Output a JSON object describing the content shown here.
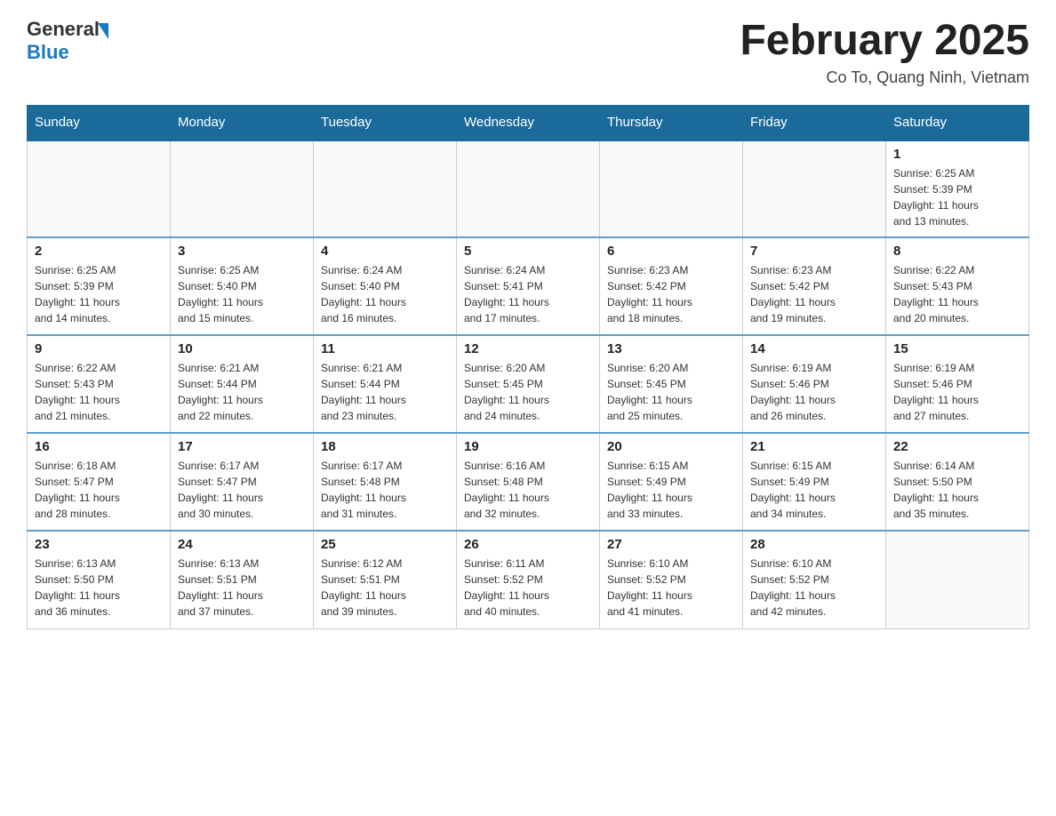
{
  "header": {
    "logo_general": "General",
    "logo_blue": "Blue",
    "month_title": "February 2025",
    "location": "Co To, Quang Ninh, Vietnam"
  },
  "weekdays": [
    "Sunday",
    "Monday",
    "Tuesday",
    "Wednesday",
    "Thursday",
    "Friday",
    "Saturday"
  ],
  "weeks": [
    [
      {
        "day": "",
        "info": ""
      },
      {
        "day": "",
        "info": ""
      },
      {
        "day": "",
        "info": ""
      },
      {
        "day": "",
        "info": ""
      },
      {
        "day": "",
        "info": ""
      },
      {
        "day": "",
        "info": ""
      },
      {
        "day": "1",
        "info": "Sunrise: 6:25 AM\nSunset: 5:39 PM\nDaylight: 11 hours\nand 13 minutes."
      }
    ],
    [
      {
        "day": "2",
        "info": "Sunrise: 6:25 AM\nSunset: 5:39 PM\nDaylight: 11 hours\nand 14 minutes."
      },
      {
        "day": "3",
        "info": "Sunrise: 6:25 AM\nSunset: 5:40 PM\nDaylight: 11 hours\nand 15 minutes."
      },
      {
        "day": "4",
        "info": "Sunrise: 6:24 AM\nSunset: 5:40 PM\nDaylight: 11 hours\nand 16 minutes."
      },
      {
        "day": "5",
        "info": "Sunrise: 6:24 AM\nSunset: 5:41 PM\nDaylight: 11 hours\nand 17 minutes."
      },
      {
        "day": "6",
        "info": "Sunrise: 6:23 AM\nSunset: 5:42 PM\nDaylight: 11 hours\nand 18 minutes."
      },
      {
        "day": "7",
        "info": "Sunrise: 6:23 AM\nSunset: 5:42 PM\nDaylight: 11 hours\nand 19 minutes."
      },
      {
        "day": "8",
        "info": "Sunrise: 6:22 AM\nSunset: 5:43 PM\nDaylight: 11 hours\nand 20 minutes."
      }
    ],
    [
      {
        "day": "9",
        "info": "Sunrise: 6:22 AM\nSunset: 5:43 PM\nDaylight: 11 hours\nand 21 minutes."
      },
      {
        "day": "10",
        "info": "Sunrise: 6:21 AM\nSunset: 5:44 PM\nDaylight: 11 hours\nand 22 minutes."
      },
      {
        "day": "11",
        "info": "Sunrise: 6:21 AM\nSunset: 5:44 PM\nDaylight: 11 hours\nand 23 minutes."
      },
      {
        "day": "12",
        "info": "Sunrise: 6:20 AM\nSunset: 5:45 PM\nDaylight: 11 hours\nand 24 minutes."
      },
      {
        "day": "13",
        "info": "Sunrise: 6:20 AM\nSunset: 5:45 PM\nDaylight: 11 hours\nand 25 minutes."
      },
      {
        "day": "14",
        "info": "Sunrise: 6:19 AM\nSunset: 5:46 PM\nDaylight: 11 hours\nand 26 minutes."
      },
      {
        "day": "15",
        "info": "Sunrise: 6:19 AM\nSunset: 5:46 PM\nDaylight: 11 hours\nand 27 minutes."
      }
    ],
    [
      {
        "day": "16",
        "info": "Sunrise: 6:18 AM\nSunset: 5:47 PM\nDaylight: 11 hours\nand 28 minutes."
      },
      {
        "day": "17",
        "info": "Sunrise: 6:17 AM\nSunset: 5:47 PM\nDaylight: 11 hours\nand 30 minutes."
      },
      {
        "day": "18",
        "info": "Sunrise: 6:17 AM\nSunset: 5:48 PM\nDaylight: 11 hours\nand 31 minutes."
      },
      {
        "day": "19",
        "info": "Sunrise: 6:16 AM\nSunset: 5:48 PM\nDaylight: 11 hours\nand 32 minutes."
      },
      {
        "day": "20",
        "info": "Sunrise: 6:15 AM\nSunset: 5:49 PM\nDaylight: 11 hours\nand 33 minutes."
      },
      {
        "day": "21",
        "info": "Sunrise: 6:15 AM\nSunset: 5:49 PM\nDaylight: 11 hours\nand 34 minutes."
      },
      {
        "day": "22",
        "info": "Sunrise: 6:14 AM\nSunset: 5:50 PM\nDaylight: 11 hours\nand 35 minutes."
      }
    ],
    [
      {
        "day": "23",
        "info": "Sunrise: 6:13 AM\nSunset: 5:50 PM\nDaylight: 11 hours\nand 36 minutes."
      },
      {
        "day": "24",
        "info": "Sunrise: 6:13 AM\nSunset: 5:51 PM\nDaylight: 11 hours\nand 37 minutes."
      },
      {
        "day": "25",
        "info": "Sunrise: 6:12 AM\nSunset: 5:51 PM\nDaylight: 11 hours\nand 39 minutes."
      },
      {
        "day": "26",
        "info": "Sunrise: 6:11 AM\nSunset: 5:52 PM\nDaylight: 11 hours\nand 40 minutes."
      },
      {
        "day": "27",
        "info": "Sunrise: 6:10 AM\nSunset: 5:52 PM\nDaylight: 11 hours\nand 41 minutes."
      },
      {
        "day": "28",
        "info": "Sunrise: 6:10 AM\nSunset: 5:52 PM\nDaylight: 11 hours\nand 42 minutes."
      },
      {
        "day": "",
        "info": ""
      }
    ]
  ]
}
